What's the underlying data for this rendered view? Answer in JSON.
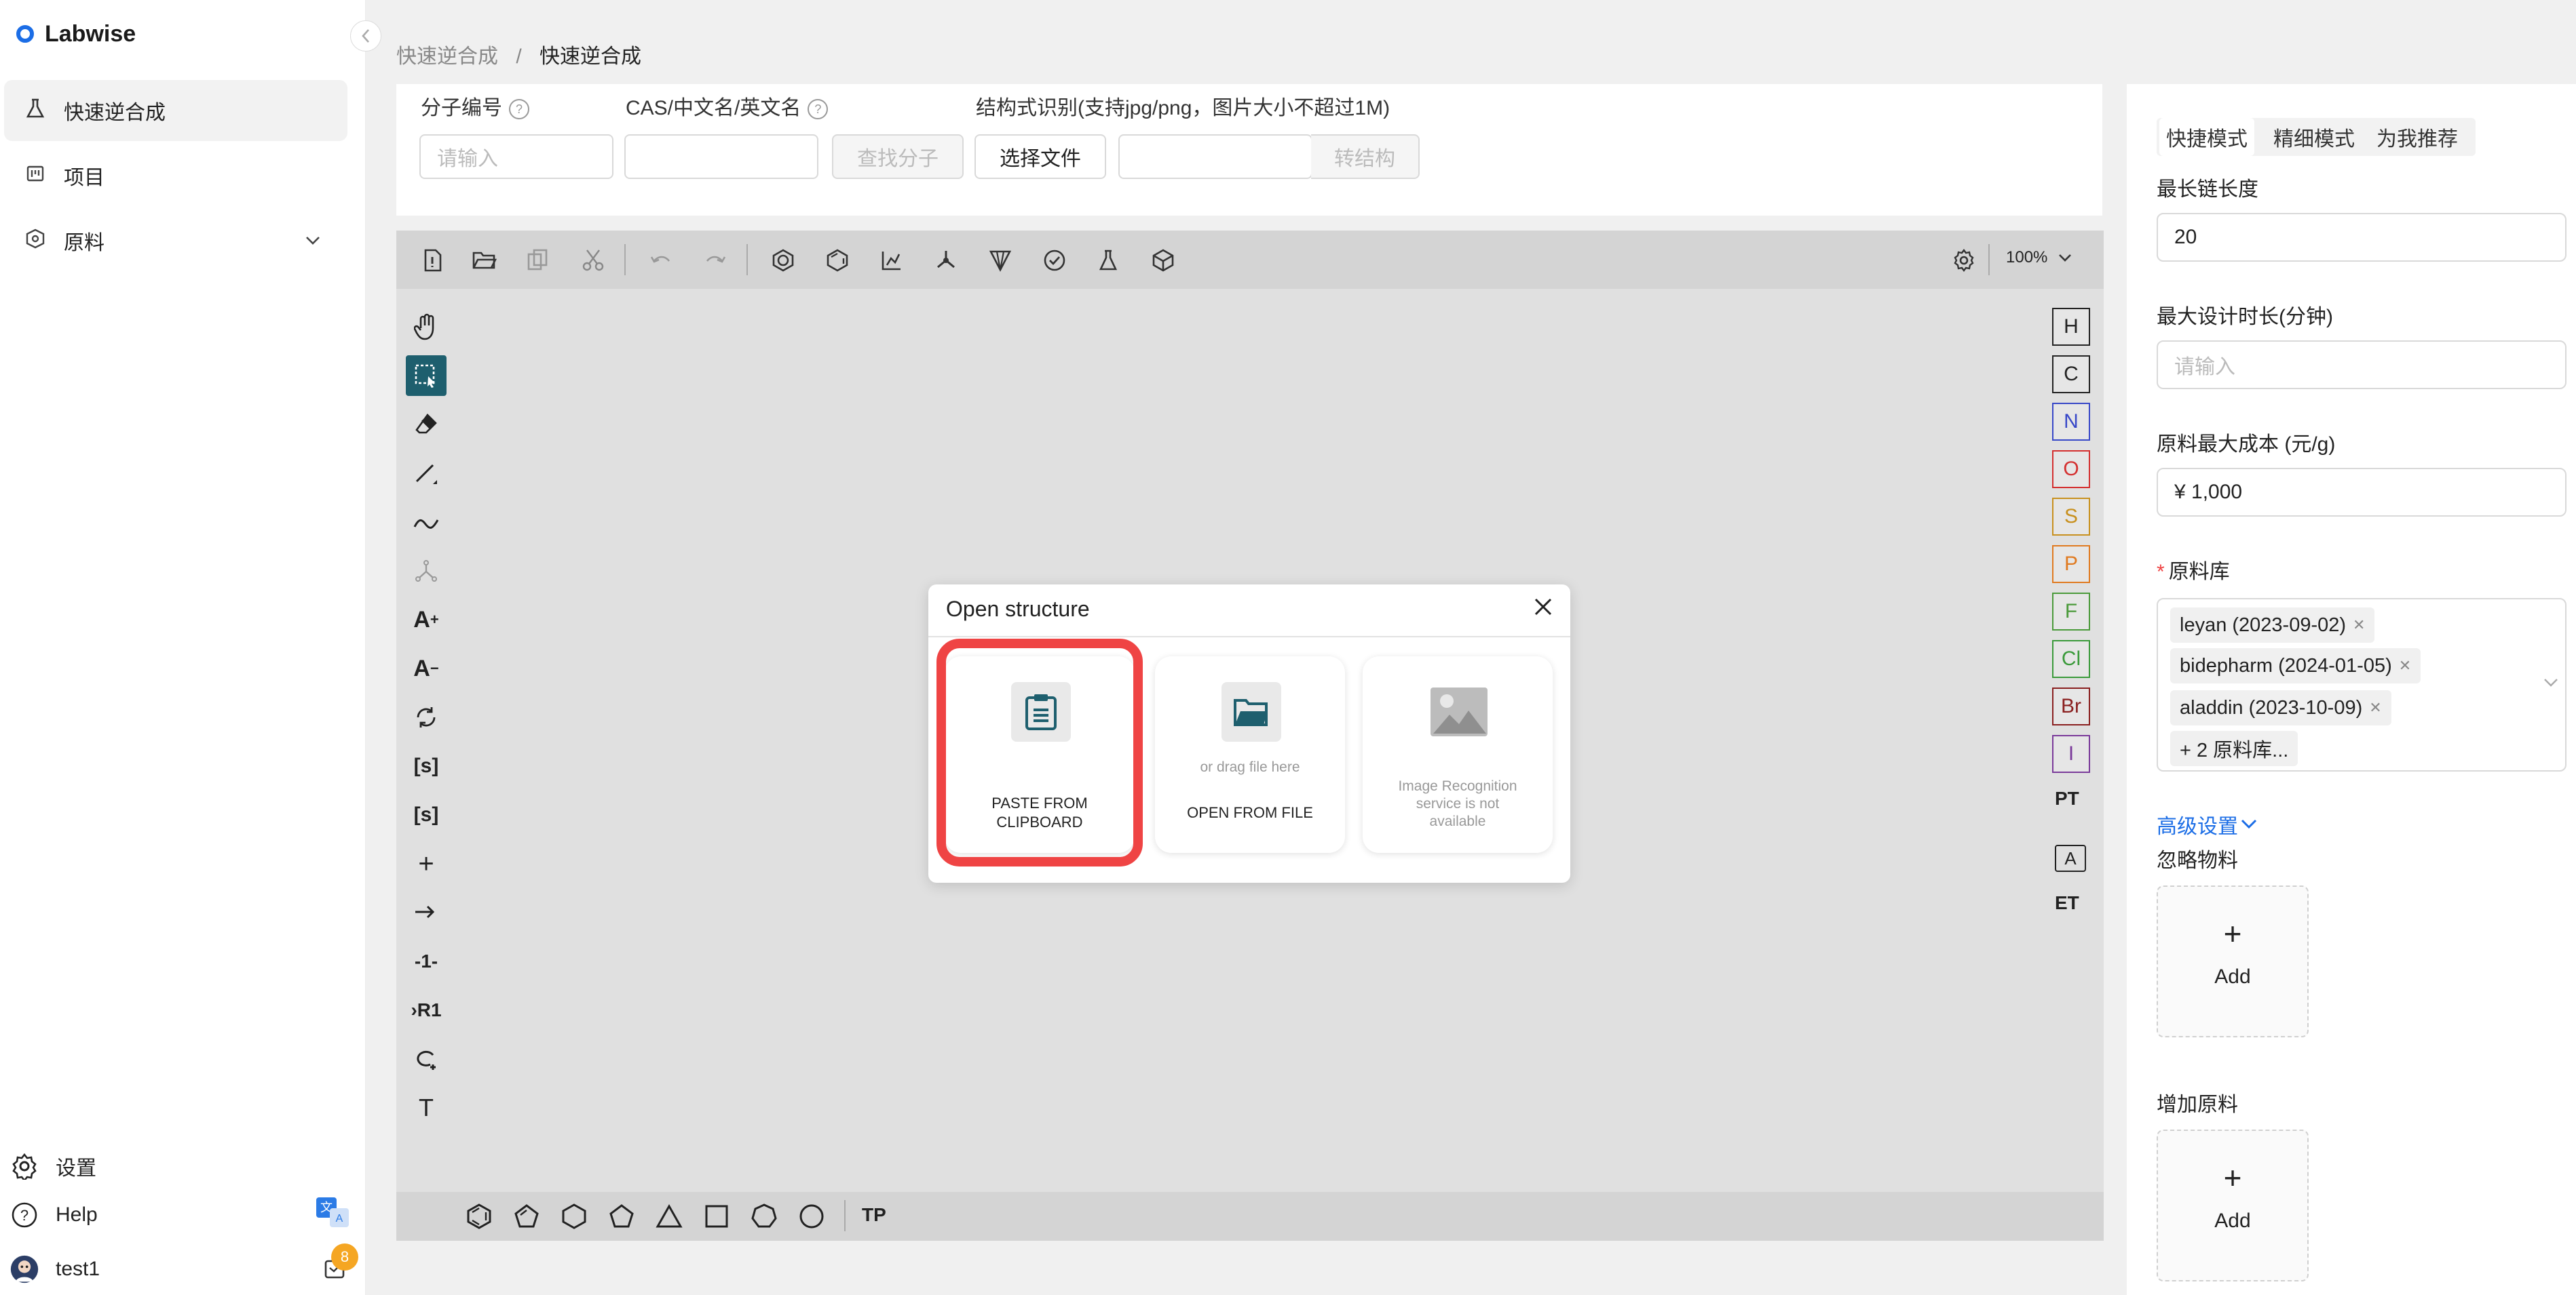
{
  "app": {
    "name": "Labwise"
  },
  "sidebar": {
    "items": [
      {
        "label": "快速逆合成",
        "icon": "flask-icon",
        "active": true
      },
      {
        "label": "项目",
        "icon": "board-icon"
      },
      {
        "label": "原料",
        "icon": "hexagon-icon",
        "has_submenu": true
      }
    ],
    "bottom": {
      "settings_label": "设置",
      "help_label": "Help",
      "user_name": "test1",
      "notification_count": "8"
    }
  },
  "breadcrumb": {
    "parent": "快速逆合成",
    "separator": "/",
    "current": "快速逆合成"
  },
  "search": {
    "molecule_id_label": "分子编号",
    "molecule_id_placeholder": "请输入",
    "name_label": "CAS/中文名/英文名",
    "find_button": "查找分子",
    "structure_recognition_label": "结构式识别(支持jpg/png，图片大小不超过1M)",
    "choose_file_button": "选择文件",
    "convert_button": "转结构"
  },
  "editor": {
    "zoom": "100%",
    "atoms": [
      "H",
      "C",
      "N",
      "O",
      "S",
      "P",
      "F",
      "Cl",
      "Br",
      "I"
    ],
    "atom_colors": {
      "H": "#222222",
      "C": "#222222",
      "N": "#3848c8",
      "O": "#d43030",
      "S": "#c8901e",
      "P": "#e07a20",
      "F": "#4a9a3a",
      "Cl": "#3a9a3a",
      "Br": "#8a2020",
      "I": "#7a3a9a"
    },
    "periodic_table_label": "PT",
    "extended_table_label": "ET",
    "templates_label": "TP"
  },
  "dialog": {
    "title": "Open structure",
    "paste_label_1": "PASTE FROM",
    "paste_label_2": "CLIPBOARD",
    "drag_hint": "or drag file here",
    "open_file_label": "OPEN FROM FILE",
    "image_rec_1": "Image Recognition",
    "image_rec_2": "service is not",
    "image_rec_3": "available",
    "highlight_color": "#ef4444"
  },
  "right_panel": {
    "modes": [
      "快捷模式",
      "精细模式",
      "为我推荐"
    ],
    "max_chain_label": "最长链长度",
    "max_chain_value": "20",
    "max_time_label": "最大设计时长(分钟)",
    "max_time_placeholder": "请输入",
    "max_cost_label": "原料最大成本 (元/g)",
    "max_cost_value": "¥ 1,000",
    "library_label": "原料库",
    "libraries": [
      "leyan (2023-09-02)",
      "bidepharm (2024-01-05)",
      "aladdin (2023-10-09)"
    ],
    "libraries_more": "+ 2 原料库...",
    "advanced_label": "高级设置",
    "ignore_label": "忽略物料",
    "add_label": "Add",
    "add_material_label": "增加原料",
    "accent_color": "#1b6de6"
  }
}
